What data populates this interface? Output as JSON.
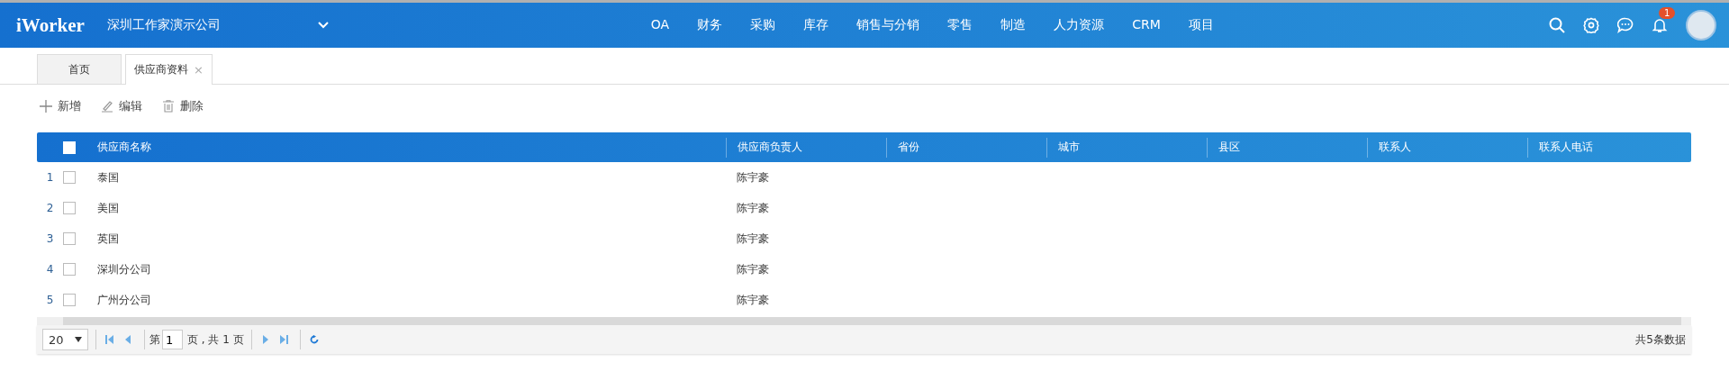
{
  "header": {
    "logo": "iWorker",
    "company": "深圳工作家演示公司",
    "nav": [
      "OA",
      "财务",
      "采购",
      "库存",
      "销售与分销",
      "零售",
      "制造",
      "人力资源",
      "CRM",
      "项目"
    ],
    "notification_badge": "1"
  },
  "tabs": [
    {
      "label": "首页",
      "selected": false
    },
    {
      "label": "供应商资料",
      "selected": true,
      "close": "×"
    }
  ],
  "toolbar": [
    {
      "kind": "add",
      "label": "新增"
    },
    {
      "kind": "edit",
      "label": "编辑"
    },
    {
      "kind": "delete",
      "label": "删除"
    }
  ],
  "table": {
    "header_checked": false,
    "columns": [
      "供应商名称",
      "供应商负责人",
      "省份",
      "城市",
      "县区",
      "联系人",
      "联系人电话"
    ],
    "rows": [
      {
        "index": "1",
        "checked": false,
        "cells": [
          "泰国",
          "陈宇豪"
        ]
      },
      {
        "index": "2",
        "checked": false,
        "cells": [
          "美国",
          "陈宇豪"
        ]
      },
      {
        "index": "3",
        "checked": false,
        "cells": [
          "英国",
          "陈宇豪"
        ]
      },
      {
        "index": "4",
        "checked": false,
        "cells": [
          "深圳分公司",
          "陈宇豪"
        ]
      },
      {
        "index": "5",
        "checked": false,
        "cells": [
          "广州分公司",
          "陈宇豪"
        ]
      }
    ]
  },
  "pager": {
    "page_size": "20",
    "page_label": "第",
    "page": "1",
    "page_total": "页 , 共 1 页",
    "summary": "共5条数据"
  }
}
